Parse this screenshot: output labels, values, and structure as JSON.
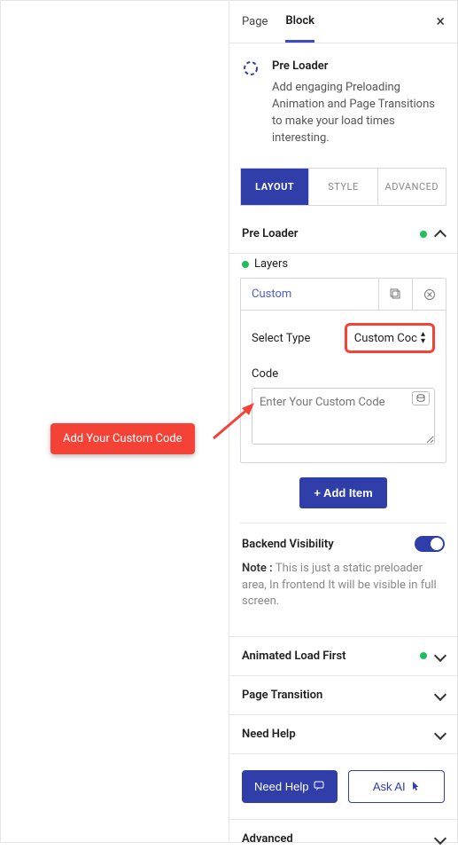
{
  "top_tabs": {
    "page": "Page",
    "block": "Block"
  },
  "block": {
    "title": "Pre Loader",
    "desc": "Add engaging Preloading Animation and Page Transitions to make your load times interesting."
  },
  "ltabs": {
    "layout": "LAYOUT",
    "style": "STYLE",
    "advanced": "ADVANCED"
  },
  "sections": {
    "preloader": "Pre Loader",
    "layers": "Layers",
    "animated_load_first": "Animated Load First",
    "page_transition": "Page Transition",
    "need_help": "Need Help",
    "advanced": "Advanced"
  },
  "layers_card": {
    "header": "Custom",
    "select_type_label": "Select Type",
    "select_type_value": "Custom Coc",
    "code_label": "Code",
    "code_placeholder": "Enter Your Custom Code"
  },
  "add_item": "+ Add Item",
  "backend_visibility": {
    "label": "Backend Visibility",
    "note_prefix": "Note : ",
    "note_text": "This is just a static preloader area, In frontend It will be visible in full screen."
  },
  "buttons": {
    "need_help": "Need Help",
    "ask_ai": "Ask AI"
  },
  "annotation": "Add Your Custom Code"
}
